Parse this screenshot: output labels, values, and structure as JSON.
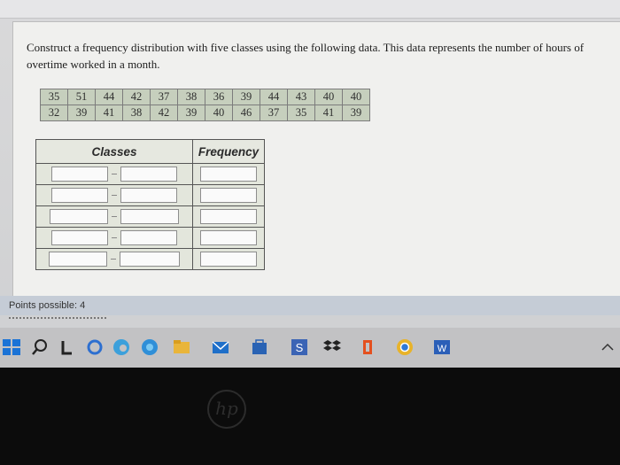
{
  "question": "Construct a frequency distribution with five classes using the following data. This data represents the number of hours of overtime worked in a month.",
  "data_rows": [
    [
      "35",
      "51",
      "44",
      "42",
      "37",
      "38",
      "36",
      "39",
      "44",
      "43",
      "40",
      "40"
    ],
    [
      "32",
      "39",
      "41",
      "38",
      "42",
      "39",
      "40",
      "46",
      "37",
      "35",
      "41",
      "39"
    ]
  ],
  "table": {
    "classes_header": "Classes",
    "frequency_header": "Frequency",
    "row_count": 5
  },
  "points_possible": "Points possible: 4",
  "taskbar_icons": [
    "windows-start-icon",
    "search-icon",
    "task-view-icon",
    "cortana-icon",
    "edge-icon",
    "file-explorer-icon",
    "mail-icon",
    "store-icon",
    "s-app-icon",
    "dropbox-icon",
    "office-icon",
    "chrome-icon",
    "word-icon"
  ],
  "hp_logo": "hp"
}
